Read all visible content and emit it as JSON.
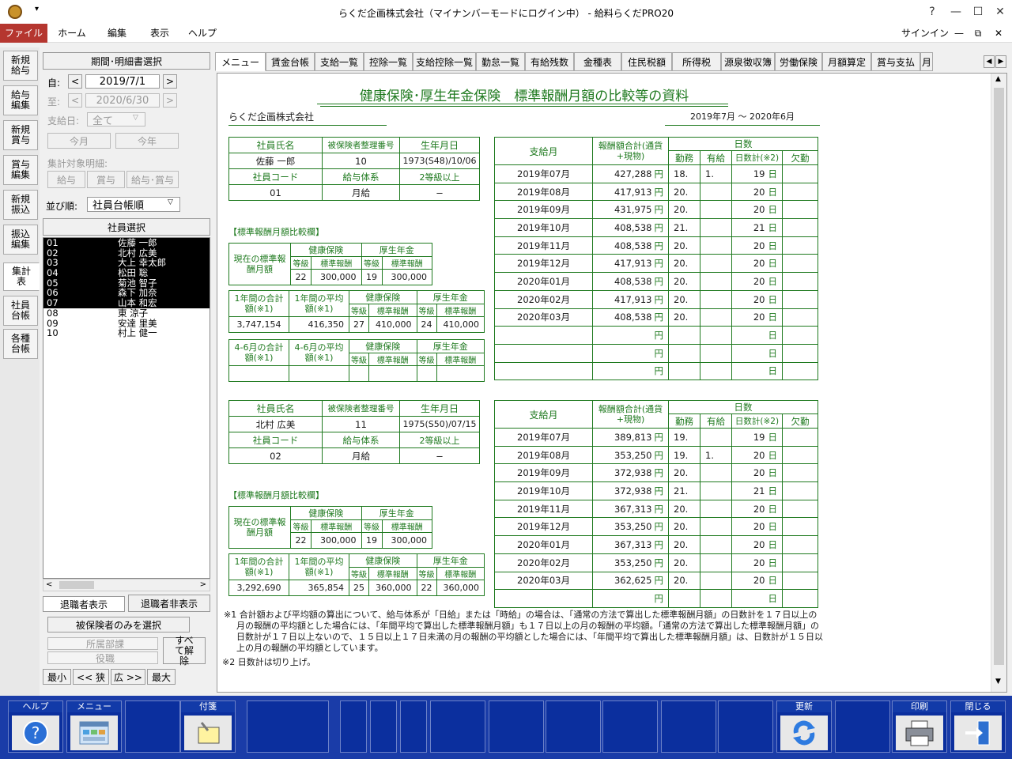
{
  "window": {
    "title": "らくだ企画株式会社（マイナンバーモードにログイン中） - 給料らくだPRO20",
    "signin": "サインイン",
    "help_q": "?",
    "min": "—",
    "max": "☐",
    "close": "✕"
  },
  "ribbon": {
    "tabs": [
      "ファイル",
      "ホーム",
      "編集",
      "表示",
      "ヘルプ"
    ]
  },
  "vtabs": [
    "新規給与",
    "給与編集",
    "新規賞与",
    "賞与編集",
    "新規振込",
    "振込編集",
    "集計表",
    "社員台帳",
    "各種台帳"
  ],
  "left": {
    "period_header": "期間･明細書選択",
    "from_label": "自:",
    "from_value": "2019/7/1",
    "to_label": "至:",
    "to_value": "2020/6/30",
    "payday_label": "支給日:",
    "payday_value": "全て",
    "btn_month": "今月",
    "btn_year": "今年",
    "target_label": "集計対象明細:",
    "target_btns": [
      "給与",
      "賞与",
      "給与･賞与"
    ],
    "sort_label": "並び順:",
    "sort_value": "社員台帳順",
    "emp_header": "社員選択",
    "employees": [
      {
        "code": "01",
        "name": "佐藤 一郎",
        "selected": true
      },
      {
        "code": "02",
        "name": "北村 広美",
        "selected": true
      },
      {
        "code": "03",
        "name": "大上 幸太郎",
        "selected": true
      },
      {
        "code": "04",
        "name": "松田 聡",
        "selected": true
      },
      {
        "code": "05",
        "name": "菊池 智子",
        "selected": true
      },
      {
        "code": "06",
        "name": "森下 加奈",
        "selected": true
      },
      {
        "code": "07",
        "name": "山本 和宏",
        "selected": true
      },
      {
        "code": "08",
        "name": "東 涼子",
        "selected": false
      },
      {
        "code": "09",
        "name": "安達 里美",
        "selected": false
      },
      {
        "code": "10",
        "name": "村上 健一",
        "selected": false
      }
    ],
    "btn_show_retired": "退職者表示",
    "btn_hide_retired": "退職者非表示",
    "btn_insured_only": "被保険者のみを選択",
    "dept_placeholder": "所属部課",
    "role_placeholder": "役職",
    "btn_clear_all": "すべて解除",
    "size_btns": [
      "最小",
      "<< 狭",
      "広 >>",
      "最大"
    ]
  },
  "tabs": [
    "メニュー",
    "賃金台帳",
    "支給一覧",
    "控除一覧",
    "支給控除一覧",
    "勤怠一覧",
    "有給残数",
    "金種表",
    "住民税額",
    "所得税",
    "源泉徴収簿",
    "労働保険",
    "月額算定",
    "賞与支払",
    "月"
  ],
  "doc": {
    "title": "健康保険･厚生年金保険　標準報酬月額の比較等の資料",
    "company": "らくだ企画株式会社",
    "period": "2019年7月 〜 2020年6月",
    "h_name": "社員氏名",
    "h_insno": "被保険者整理番号",
    "h_birth": "生年月日",
    "h_code": "社員コード",
    "h_paysys": "給与体系",
    "h_grade_note": "2等級以上",
    "std_title": "【標準報酬月額比較欄】",
    "current_std": "現在の標準報酬月額",
    "health": "健康保険",
    "pension": "厚生年金",
    "grade": "等級",
    "std_pay": "標準報酬",
    "yr_total": "1年間の合計額(※1)",
    "yr_avg": "1年間の平均額(※1)",
    "q_total": "4-6月の合計額(※1)",
    "q_avg": "4-6月の平均額(※1)",
    "h_paymonth": "支給月",
    "h_paytotal": "報酬額合計(通貨+現物)",
    "h_days": "日数",
    "h_work": "勤務",
    "h_paid": "有給",
    "h_daycount": "日数計(※2)",
    "h_absent": "欠勤",
    "yen": "円",
    "day": "日",
    "employees": [
      {
        "name": "佐藤 一郎",
        "insno": "10",
        "birth": "1973(S48)/10/06",
        "code": "01",
        "paysys": "月給",
        "dash": "−",
        "cur": {
          "hg": "22",
          "hs": "300,000",
          "pg": "19",
          "ps": "300,000"
        },
        "yr": {
          "total": "3,747,154",
          "avg": "416,350",
          "hg": "27",
          "hs": "410,000",
          "pg": "24",
          "ps": "410,000"
        },
        "months": [
          {
            "m": "2019年07月",
            "amt": "427,288",
            "work": "18.",
            "paid": "1.",
            "days": "19"
          },
          {
            "m": "2019年08月",
            "amt": "417,913",
            "work": "20.",
            "paid": "",
            "days": "20"
          },
          {
            "m": "2019年09月",
            "amt": "431,975",
            "work": "20.",
            "paid": "",
            "days": "20"
          },
          {
            "m": "2019年10月",
            "amt": "408,538",
            "work": "21.",
            "paid": "",
            "days": "21"
          },
          {
            "m": "2019年11月",
            "amt": "408,538",
            "work": "20.",
            "paid": "",
            "days": "20"
          },
          {
            "m": "2019年12月",
            "amt": "417,913",
            "work": "20.",
            "paid": "",
            "days": "20"
          },
          {
            "m": "2020年01月",
            "amt": "408,538",
            "work": "20.",
            "paid": "",
            "days": "20"
          },
          {
            "m": "2020年02月",
            "amt": "417,913",
            "work": "20.",
            "paid": "",
            "days": "20"
          },
          {
            "m": "2020年03月",
            "amt": "408,538",
            "work": "20.",
            "paid": "",
            "days": "20"
          }
        ]
      },
      {
        "name": "北村 広美",
        "insno": "11",
        "birth": "1975(S50)/07/15",
        "code": "02",
        "paysys": "月給",
        "dash": "−",
        "cur": {
          "hg": "22",
          "hs": "300,000",
          "pg": "19",
          "ps": "300,000"
        },
        "yr": {
          "total": "3,292,690",
          "avg": "365,854",
          "hg": "25",
          "hs": "360,000",
          "pg": "22",
          "ps": "360,000"
        },
        "months": [
          {
            "m": "2019年07月",
            "amt": "389,813",
            "work": "19.",
            "paid": "",
            "days": "19"
          },
          {
            "m": "2019年08月",
            "amt": "353,250",
            "work": "19.",
            "paid": "1.",
            "days": "20"
          },
          {
            "m": "2019年09月",
            "amt": "372,938",
            "work": "20.",
            "paid": "",
            "days": "20"
          },
          {
            "m": "2019年10月",
            "amt": "372,938",
            "work": "21.",
            "paid": "",
            "days": "21"
          },
          {
            "m": "2019年11月",
            "amt": "367,313",
            "work": "20.",
            "paid": "",
            "days": "20"
          },
          {
            "m": "2019年12月",
            "amt": "353,250",
            "work": "20.",
            "paid": "",
            "days": "20"
          },
          {
            "m": "2020年01月",
            "amt": "367,313",
            "work": "20.",
            "paid": "",
            "days": "20"
          },
          {
            "m": "2020年02月",
            "amt": "353,250",
            "work": "20.",
            "paid": "",
            "days": "20"
          },
          {
            "m": "2020年03月",
            "amt": "362,625",
            "work": "20.",
            "paid": "",
            "days": "20"
          }
        ]
      }
    ],
    "note1": "※1 合計額および平均額の算出について、給与体系が「日給」または「時給」の場合は、「通常の方法で算出した標準報酬月額」の日数計を１７日以上の月の報酬の平均額とした場合には、「年間平均で算出した標準報酬月額」も１７日以上の月の報酬の平均額。「通常の方法で算出した標準報酬月額」の日数計が１７日以上ないので、１５日以上１７日未満の月の報酬の平均額とした場合には、「年間平均で算出した標準報酬月額」は、日数計が１５日以上の月の報酬の平均額としています。",
    "note2": "※2 日数計は切り上げ。"
  },
  "fkeys": {
    "help": "ヘルプ",
    "menu": "メニュー",
    "tag": "付箋",
    "update": "更新",
    "print": "印刷",
    "close": "閉じる"
  }
}
